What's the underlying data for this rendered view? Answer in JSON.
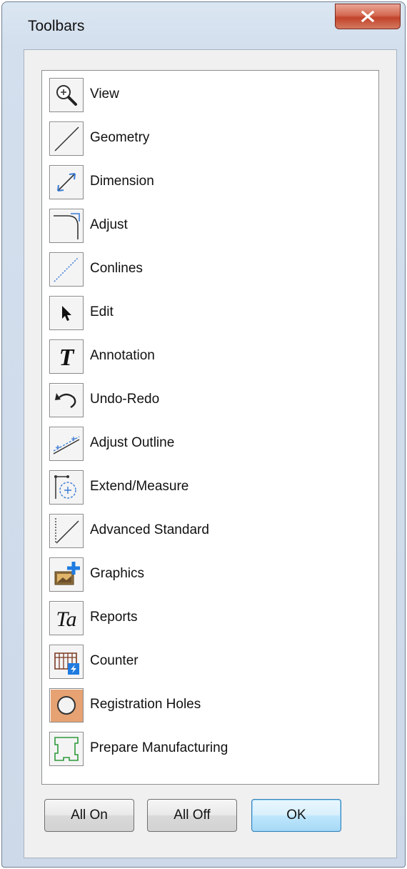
{
  "window": {
    "title": "Toolbars",
    "close_icon": "close-x-icon"
  },
  "toolbars": [
    {
      "label": "View",
      "icon": "zoom-magnifier-icon"
    },
    {
      "label": "Geometry",
      "icon": "line-icon"
    },
    {
      "label": "Dimension",
      "icon": "dimension-arrow-icon"
    },
    {
      "label": "Adjust",
      "icon": "fillet-corner-icon"
    },
    {
      "label": "Conlines",
      "icon": "construction-line-icon"
    },
    {
      "label": "Edit",
      "icon": "pointer-arrow-icon"
    },
    {
      "label": "Annotation",
      "icon": "text-t-icon"
    },
    {
      "label": "Undo-Redo",
      "icon": "undo-icon"
    },
    {
      "label": "Adjust Outline",
      "icon": "adjust-outline-icon"
    },
    {
      "label": "Extend/Measure",
      "icon": "extend-measure-icon"
    },
    {
      "label": "Advanced Standard",
      "icon": "advanced-line-icon"
    },
    {
      "label": "Graphics",
      "icon": "graphics-add-icon"
    },
    {
      "label": "Reports",
      "icon": "reports-ta-icon"
    },
    {
      "label": "Counter",
      "icon": "counter-icon"
    },
    {
      "label": "Registration Holes",
      "icon": "registration-hole-icon"
    },
    {
      "label": "Prepare Manufacturing",
      "icon": "prepare-manufacturing-icon"
    }
  ],
  "buttons": {
    "all_on": "All On",
    "all_off": "All Off",
    "ok": "OK"
  },
  "colors": {
    "accent_blue": "#3a7bd5",
    "close_red": "#c2432a",
    "registration_orange": "#e6a272",
    "manufacturing_green": "#2f9a3a"
  }
}
